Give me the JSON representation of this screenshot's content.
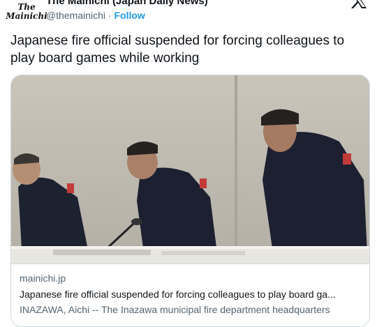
{
  "account": {
    "avatar_line1": "The",
    "avatar_line2": "Mainichi",
    "display_name": "The Mainichi (Japan Daily News)",
    "handle": "@themainichi",
    "separator": " · ",
    "follow_label": "Follow"
  },
  "post": {
    "text": "Japanese fire official suspended for forcing colleagues to play board games while working"
  },
  "card": {
    "domain": "mainichi.jp",
    "title": "Japanese fire official suspended for forcing colleagues to play board ga...",
    "description": "INAZAWA, Aichi -- The Inazawa municipal fire department headquarters"
  },
  "colors": {
    "accent": "#1d9bf0",
    "secondary_text": "#536471",
    "border": "#cfd9de"
  },
  "icons": {
    "close": "x-logo-icon"
  }
}
